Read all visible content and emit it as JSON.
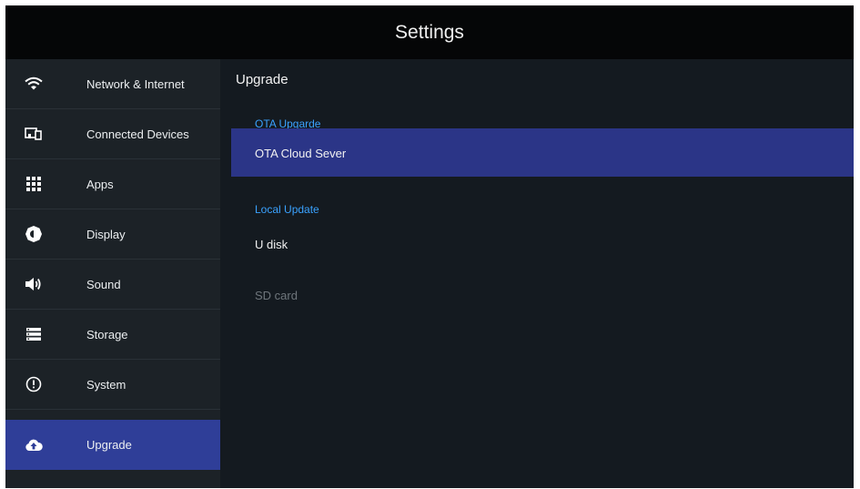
{
  "header": {
    "title": "Settings"
  },
  "sidebar": {
    "items": [
      {
        "label": "Network & Internet",
        "icon": "wifi-icon"
      },
      {
        "label": "Connected Devices",
        "icon": "devices-icon"
      },
      {
        "label": "Apps",
        "icon": "apps-grid-icon"
      },
      {
        "label": "Display",
        "icon": "brightness-icon"
      },
      {
        "label": "Sound",
        "icon": "speaker-icon"
      },
      {
        "label": "Storage",
        "icon": "storage-icon"
      },
      {
        "label": "System",
        "icon": "info-icon"
      },
      {
        "label": "Upgrade",
        "icon": "cloud-upload-icon",
        "selected": true
      }
    ]
  },
  "main": {
    "title": "Upgrade",
    "sections": [
      {
        "header": "OTA Upgarde",
        "options": [
          {
            "label": "OTA Cloud Sever",
            "selected": true
          }
        ]
      },
      {
        "header": "Local Update",
        "options": [
          {
            "label": "U disk"
          },
          {
            "label": "SD card",
            "disabled": true
          }
        ]
      }
    ]
  },
  "colors": {
    "accent": "#3aa2ff",
    "selected_sidebar": "#2f3e98",
    "selected_row": "#2b3587",
    "background": "#141a20"
  }
}
